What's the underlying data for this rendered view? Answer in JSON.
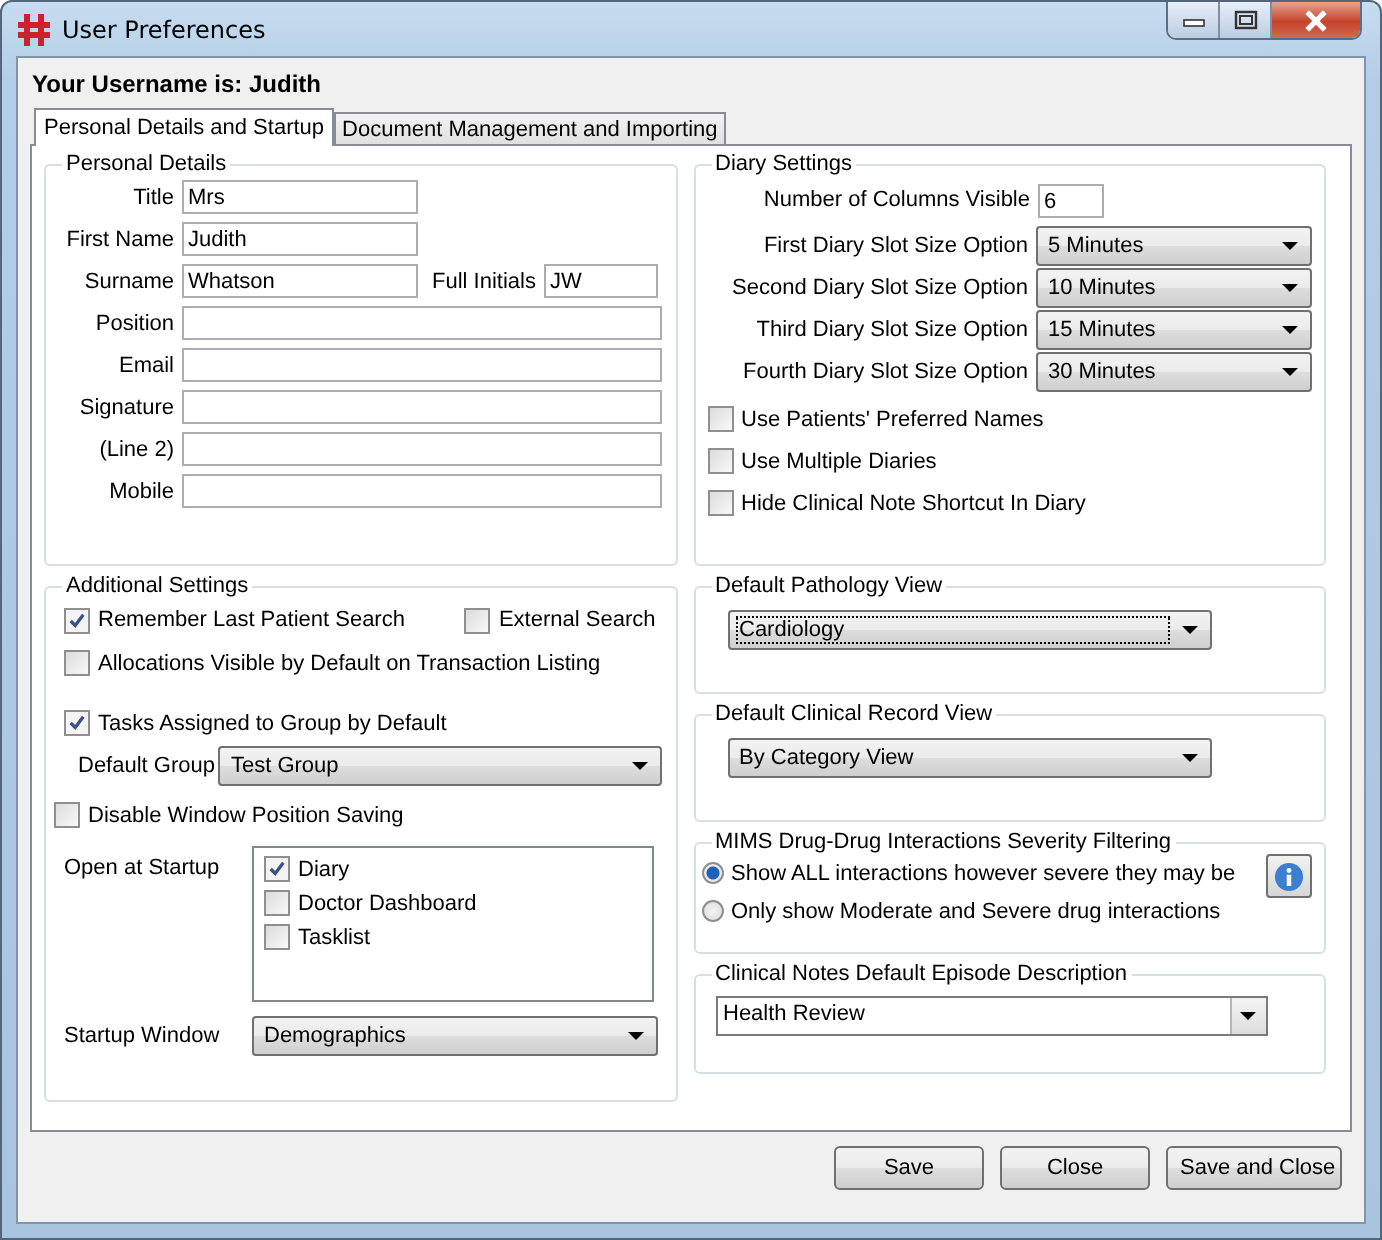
{
  "window": {
    "title": "User Preferences"
  },
  "username_label": "Your Username is: Judith",
  "tabs": [
    {
      "label": "Personal Details and Startup",
      "selected": true
    },
    {
      "label": "Document Management and Importing",
      "selected": false
    }
  ],
  "personal_details": {
    "title": "Personal Details",
    "fields": [
      {
        "label": "Title",
        "value": "Mrs",
        "kind": "short"
      },
      {
        "label": "First Name",
        "value": "Judith",
        "kind": "short"
      },
      {
        "label": "Surname",
        "value": "Whatson",
        "kind": "short",
        "side_field": {
          "label": "Full Initials",
          "value": "JW"
        }
      },
      {
        "label": "Position",
        "kind": "wide"
      },
      {
        "label": "Email",
        "kind": "wide"
      },
      {
        "label": "Signature",
        "kind": "wide"
      },
      {
        "label": "(Line 2)",
        "kind": "wide"
      },
      {
        "label": "Mobile",
        "kind": "wide"
      }
    ]
  },
  "additional_settings": {
    "title": "Additional Settings",
    "remember_last_patient_search": {
      "label": "Remember Last Patient Search",
      "checked": true
    },
    "external_search": {
      "label": "External Search",
      "checked": false
    },
    "allocations_visible": {
      "label": "Allocations Visible by Default on Transaction Listing",
      "checked": false
    },
    "tasks_assigned_to_group": {
      "label": "Tasks Assigned to Group by Default",
      "checked": true
    },
    "default_group": {
      "label": "Default Group",
      "value": "Test Group"
    },
    "disable_window_position_saving": {
      "label": "Disable Window Position Saving",
      "checked": false
    },
    "open_at_startup": {
      "label": "Open at Startup",
      "items": [
        {
          "label": "Diary",
          "checked": true
        },
        {
          "label": "Doctor Dashboard",
          "checked": false
        },
        {
          "label": "Tasklist",
          "checked": false
        }
      ]
    },
    "startup_window": {
      "label": "Startup Window",
      "value": "Demographics"
    }
  },
  "diary_settings": {
    "title": "Diary Settings",
    "columns_visible": {
      "label": "Number of Columns Visible",
      "value": "6"
    },
    "slot_options": [
      {
        "label": "First Diary Slot Size Option",
        "value": "5 Minutes"
      },
      {
        "label": "Second Diary Slot Size Option",
        "value": "10 Minutes"
      },
      {
        "label": "Third Diary Slot Size Option",
        "value": "15 Minutes"
      },
      {
        "label": "Fourth Diary Slot Size Option",
        "value": "30 Minutes"
      }
    ],
    "checkboxes": [
      {
        "label": "Use Patients' Preferred Names",
        "checked": false
      },
      {
        "label": "Use Multiple Diaries",
        "checked": false
      },
      {
        "label": "Hide Clinical Note Shortcut In Diary",
        "checked": false
      }
    ]
  },
  "pathology_view": {
    "title": "Default Pathology View",
    "value": "Cardiology",
    "focused": true
  },
  "clinical_record_view": {
    "title": "Default Clinical Record View",
    "value": "By Category View",
    "focused": false
  },
  "mims_filtering": {
    "title": "MIMS Drug-Drug Interactions Severity Filtering",
    "options": [
      {
        "label": "Show ALL interactions however severe they may be",
        "selected": true
      },
      {
        "label": "Only show Moderate and Severe drug interactions",
        "selected": false
      }
    ]
  },
  "episode_description": {
    "title": "Clinical Notes Default Episode Description",
    "value": "Health Review"
  },
  "buttons": [
    "Save",
    "Close",
    "Save and Close"
  ]
}
